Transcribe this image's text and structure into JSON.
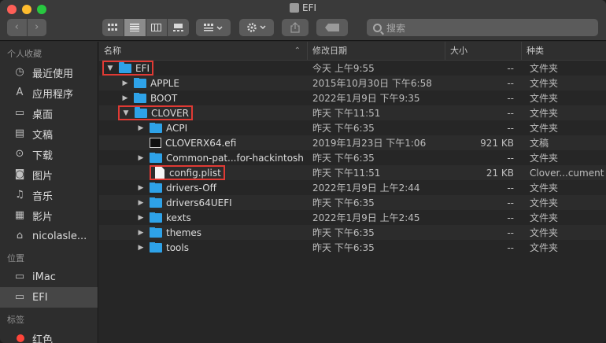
{
  "window": {
    "title": "EFI"
  },
  "toolbar": {
    "back": "‹",
    "forward": "›",
    "search_placeholder": "搜索"
  },
  "sidebar": {
    "favorites_header": "个人收藏",
    "favorites": [
      {
        "label": "最近使用",
        "icon": "recent-icon"
      },
      {
        "label": "应用程序",
        "icon": "applications-icon"
      },
      {
        "label": "桌面",
        "icon": "desktop-icon"
      },
      {
        "label": "文稿",
        "icon": "documents-icon"
      },
      {
        "label": "下载",
        "icon": "downloads-icon"
      },
      {
        "label": "图片",
        "icon": "pictures-icon"
      },
      {
        "label": "音乐",
        "icon": "music-icon"
      },
      {
        "label": "影片",
        "icon": "movies-icon"
      },
      {
        "label": "nicolasle...",
        "icon": "home-icon"
      }
    ],
    "locations_header": "位置",
    "locations": [
      {
        "label": "iMac",
        "icon": "disk-icon"
      },
      {
        "label": "EFI",
        "icon": "disk-icon",
        "selected": true
      }
    ],
    "tags_header": "标签",
    "tags": [
      {
        "label": "红色",
        "color": "#ff453a"
      }
    ]
  },
  "columns": {
    "name": "名称",
    "date": "修改日期",
    "size": "大小",
    "kind": "种类"
  },
  "rows": [
    {
      "name": "EFI",
      "date": "今天 上午9:55",
      "size": "--",
      "kind": "文件夹",
      "level": 0,
      "type": "folder",
      "expanded": true,
      "highlight": true
    },
    {
      "name": "APPLE",
      "date": "2015年10月30日 下午6:58",
      "size": "--",
      "kind": "文件夹",
      "level": 1,
      "type": "folder",
      "expanded": false
    },
    {
      "name": "BOOT",
      "date": "2022年1月9日 下午9:35",
      "size": "--",
      "kind": "文件夹",
      "level": 1,
      "type": "folder",
      "expanded": false
    },
    {
      "name": "CLOVER",
      "date": "昨天 下午11:51",
      "size": "--",
      "kind": "文件夹",
      "level": 1,
      "type": "folder",
      "expanded": true,
      "highlight": true
    },
    {
      "name": "ACPI",
      "date": "昨天 下午6:35",
      "size": "--",
      "kind": "文件夹",
      "level": 2,
      "type": "folder",
      "expanded": false
    },
    {
      "name": "CLOVERX64.efi",
      "date": "2019年1月23日 下午1:06",
      "size": "921 KB",
      "kind": "文稿",
      "level": 2,
      "type": "exe"
    },
    {
      "name": "Common-pat...for-hackintosh",
      "date": "昨天 下午6:35",
      "size": "--",
      "kind": "文件夹",
      "level": 2,
      "type": "folder",
      "expanded": false
    },
    {
      "name": "config.plist",
      "date": "昨天 下午11:51",
      "size": "21 KB",
      "kind": "Clover...cument",
      "level": 2,
      "type": "doc",
      "highlight": true
    },
    {
      "name": "drivers-Off",
      "date": "2022年1月9日 上午2:44",
      "size": "--",
      "kind": "文件夹",
      "level": 2,
      "type": "folder",
      "expanded": false
    },
    {
      "name": "drivers64UEFI",
      "date": "昨天 下午6:35",
      "size": "--",
      "kind": "文件夹",
      "level": 2,
      "type": "folder",
      "expanded": false
    },
    {
      "name": "kexts",
      "date": "2022年1月9日 上午2:45",
      "size": "--",
      "kind": "文件夹",
      "level": 2,
      "type": "folder",
      "expanded": false
    },
    {
      "name": "themes",
      "date": "昨天 下午6:35",
      "size": "--",
      "kind": "文件夹",
      "level": 2,
      "type": "folder",
      "expanded": false
    },
    {
      "name": "tools",
      "date": "昨天 下午6:35",
      "size": "--",
      "kind": "文件夹",
      "level": 2,
      "type": "folder",
      "expanded": false
    }
  ],
  "colors": {
    "folder": "#2ea2e8",
    "highlight_box": "#e03a34"
  }
}
